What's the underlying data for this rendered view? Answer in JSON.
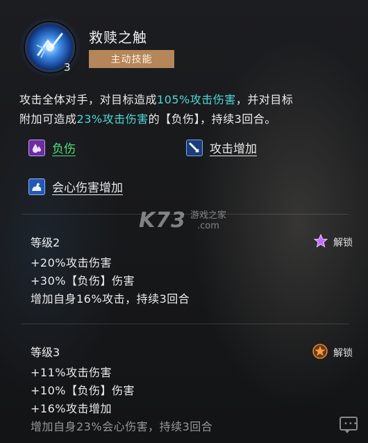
{
  "skill": {
    "title": "救赎之触",
    "type_label": "主动技能",
    "level": "3",
    "icon": "blue-crystal-skill-icon",
    "desc_line1": [
      "攻击全体对手，对目标造成",
      "105%攻击伤害",
      "，并对目标"
    ],
    "desc_line2": [
      "附加可造成",
      "23%攻击伤害",
      "的【负伤】，持续3回合。"
    ]
  },
  "buffs": [
    {
      "label": "负伤",
      "icon": "purple-droplet-icon",
      "color": "#54e07a"
    },
    {
      "label": "攻击增加",
      "icon": "sword-icon"
    },
    {
      "label": "会心伤害增加",
      "icon": "flexed-arm-icon"
    }
  ],
  "watermark": {
    "logo": "K73",
    "cn": "游戏之家",
    "com": ".com"
  },
  "levels": [
    {
      "title": "等级2",
      "unlock_label": "解锁",
      "unlock_icon": "purple-star-icon",
      "lines": [
        "+20%攻击伤害",
        "+30%【负伤】伤害",
        "增加自身16%攻击，持续3回合"
      ]
    },
    {
      "title": "等级3",
      "unlock_label": "解锁",
      "unlock_icon": "orange-star-badge-icon",
      "lines": [
        "+11%攻击伤害",
        "+10%【负伤】伤害",
        "+16%攻击增加",
        "增加自身23%会心伤害，持续3回合"
      ]
    }
  ],
  "colors": {
    "highlight": "#4fd7d9",
    "tag_bg": "#b4865a",
    "buff_green": "#54e07a"
  }
}
